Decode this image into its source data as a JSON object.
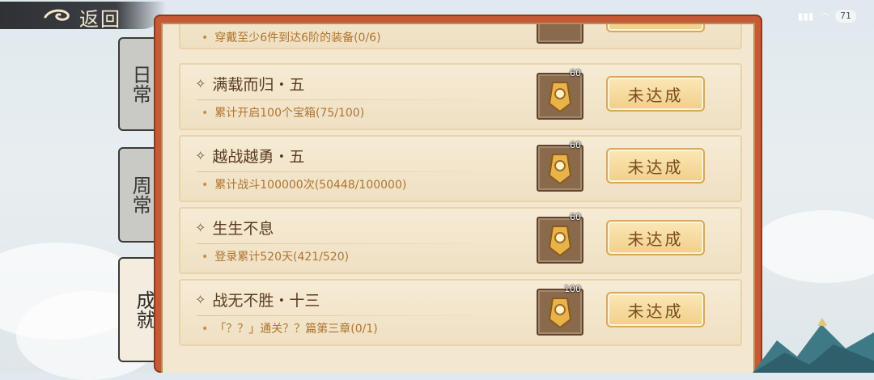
{
  "status": {
    "battery": "71"
  },
  "header": {
    "back_label": "返回"
  },
  "tabs": [
    {
      "label": "日常",
      "active": false
    },
    {
      "label": "周常",
      "active": false
    },
    {
      "label": "成就",
      "active": true
    }
  ],
  "partial_row": {
    "desc": "穿戴至少6件到达6阶的装备(0/6)"
  },
  "achievements": [
    {
      "title": "满载而归・五",
      "desc": "累计开启100个宝箱(75/100)",
      "reward_count": "60",
      "button_label": "未达成"
    },
    {
      "title": "越战越勇・五",
      "desc": "累计战斗100000次(50448/100000)",
      "reward_count": "60",
      "button_label": "未达成"
    },
    {
      "title": "生生不息",
      "desc": "登录累计520天(421/520)",
      "reward_count": "60",
      "button_label": "未达成"
    },
    {
      "title": "战无不胜・十三",
      "desc": "「？？」通关？？篇第三章(0/1)",
      "reward_count": "100",
      "button_label": "未达成"
    }
  ],
  "colors": {
    "panel_border": "#c65a34",
    "button_fill": "#f1cf88",
    "title_text": "#5a3a22",
    "desc_text": "#b0742e"
  },
  "icons": {
    "reward": "gold-scroll-icon",
    "bullet": "sparkle-star-icon"
  }
}
